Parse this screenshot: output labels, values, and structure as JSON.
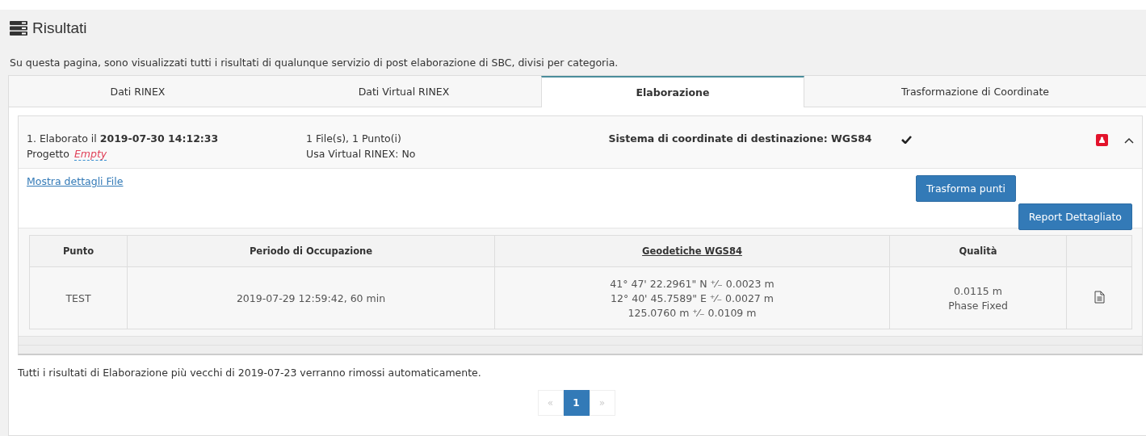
{
  "page": {
    "title": "Risultati",
    "description": "Su questa pagina, sono visualizzati tutti i risultati di qualunque servizio di post elaborazione di SBC, divisi per categoria."
  },
  "tabs": [
    {
      "label": "Dati RINEX",
      "selected": false
    },
    {
      "label": "Dati Virtual RINEX",
      "selected": false
    },
    {
      "label": "Elaborazione",
      "selected": true
    },
    {
      "label": "Trasformazione di Coordinate",
      "selected": false
    }
  ],
  "result": {
    "heading": "1. Elaborato il **2019-07-30 14:12:33**",
    "project_label": "Progetto",
    "project_value": "Empty",
    "files": "1 File(s), 1 Punto(i)",
    "virtual_rinex": "Usa Virtual RINEX: No",
    "target_system": "Sistema di coordinate di destinazione: WGS84",
    "expanded": true,
    "details_link": "Mostra dettagli File",
    "buttons": [
      "Trasforma punti",
      "Report Dettagliato"
    ],
    "table": {
      "columns": [
        {
          "label": "Punto",
          "underlined": false
        },
        {
          "label": "Periodo di Occupazione",
          "underlined": false
        },
        {
          "label": "Geodetiche WGS84",
          "underlined": true
        },
        {
          "label": "Qualità",
          "underlined": false
        }
      ],
      "rows": [
        {
          "point": "TEST",
          "period": "2019-07-29 12:59:42, 60 min",
          "coordinates": [
            "41° 47' 22.2961\" N ⁺⁄₋ 0.0023 m",
            "12° 40' 45.7589\" E ⁺⁄₋ 0.0027 m",
            "125.0760 m ⁺⁄₋ 0.0109 m"
          ],
          "quality": [
            "0.0115 m",
            "Phase Fixed"
          ]
        }
      ]
    }
  },
  "footer_note": "Tutti i risultati di Elaborazione più vecchi di 2019-07-23 verranno rimossi automaticamente.",
  "pagination": [
    {
      "label": "«",
      "selected": false,
      "disabled": true
    },
    {
      "label": "1",
      "selected": true,
      "disabled": false
    },
    {
      "label": "»",
      "selected": false,
      "disabled": true
    }
  ]
}
